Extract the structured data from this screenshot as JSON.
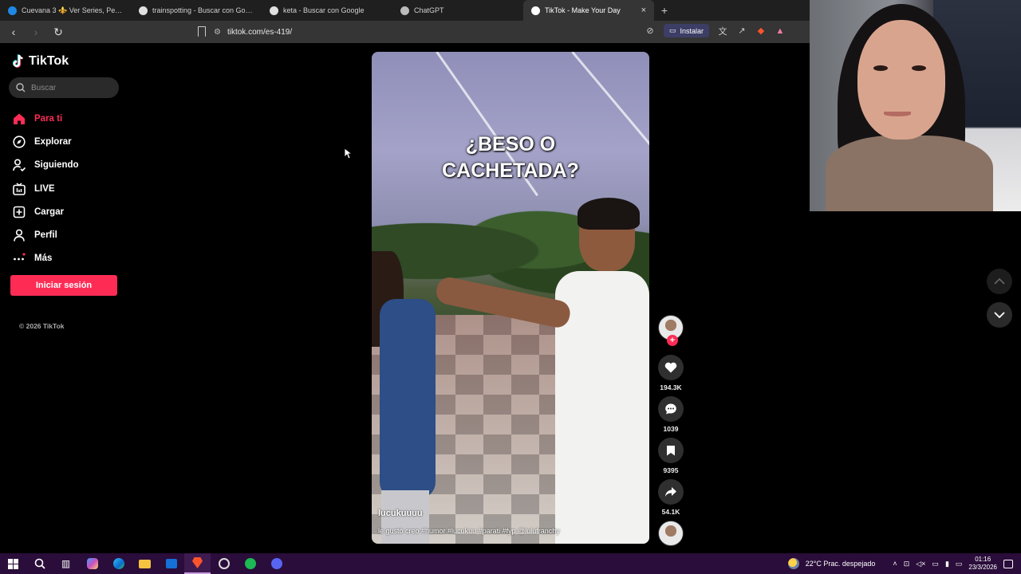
{
  "browser": {
    "tabs": [
      {
        "title": "Cuevana 3 ⚜️ Ver Series, Películas y ...",
        "favicon_color": "#1e88e5",
        "active": false
      },
      {
        "title": "trainspotting - Buscar con Google",
        "favicon_color": "#e0e0e0",
        "active": false
      },
      {
        "title": "keta - Buscar con Google",
        "favicon_color": "#e0e0e0",
        "active": false
      },
      {
        "title": "ChatGPT",
        "favicon_color": "#bbbbbb",
        "active": false
      },
      {
        "title": "TikTok - Make Your Day",
        "favicon_color": "#ffffff",
        "active": true
      }
    ],
    "new_tab": "+",
    "close_tab": "×",
    "url": "tiktok.com/es-419/",
    "install_label": "Instalar"
  },
  "tiktok": {
    "logo": "TikTok",
    "search_placeholder": "Buscar",
    "menu": [
      {
        "label": "Para ti",
        "icon": "home-icon",
        "active": true
      },
      {
        "label": "Explorar",
        "icon": "compass-icon",
        "active": false
      },
      {
        "label": "Siguiendo",
        "icon": "following-icon",
        "active": false
      },
      {
        "label": "LIVE",
        "icon": "live-icon",
        "active": false
      },
      {
        "label": "Cargar",
        "icon": "upload-icon",
        "active": false
      },
      {
        "label": "Perfil",
        "icon": "profile-icon",
        "active": false
      },
      {
        "label": "Más",
        "icon": "more-icon",
        "active": false
      }
    ],
    "login_label": "Iniciar sesión",
    "copyright": "© 2026 TikTok",
    "accent_color": "#fe2c55"
  },
  "video": {
    "overlay_line1": "¿BESO O",
    "overlay_line2": "CACHETADA?",
    "author": "lucukuuuu",
    "caption": "le gustó creo #humor #lucukuu #parati #fyp @lulufranchy",
    "likes": "194.3K",
    "comments": "1039",
    "saves": "9395",
    "shares": "54.1K"
  },
  "taskbar": {
    "weather": "22°C  Prac. despejado",
    "time": "01:16",
    "date": "23/3/2026"
  }
}
